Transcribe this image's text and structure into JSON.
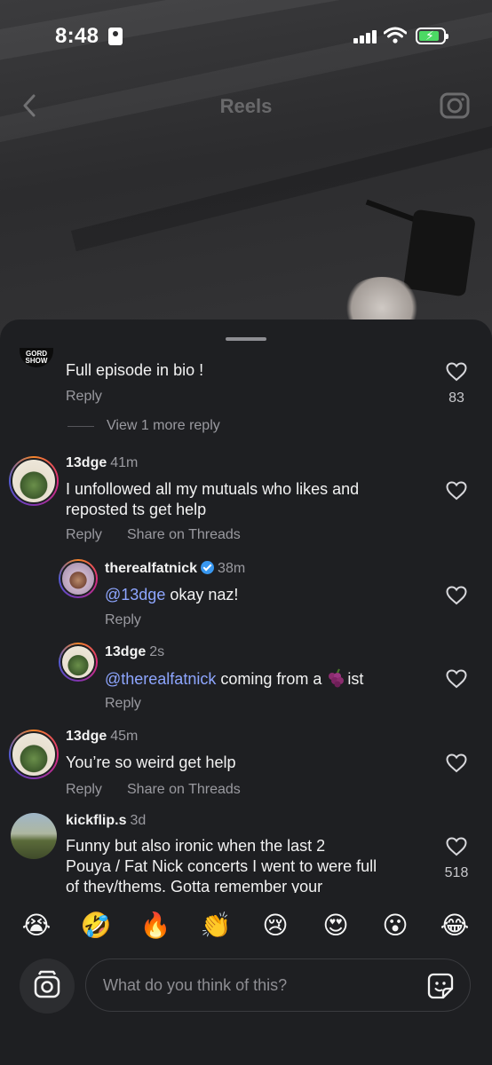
{
  "status_bar": {
    "time": "8:48"
  },
  "nav": {
    "title": "Reels"
  },
  "comments": [
    {
      "user": "",
      "text": "Full episode  in bio !",
      "reply": "Reply",
      "likes": "83"
    },
    {
      "view_more": "View 1 more reply"
    },
    {
      "user": "13dge",
      "time": "41m",
      "text_line1": "I unfollowed all my mutuals who likes and",
      "text_line2": "reposted ts get help",
      "reply": "Reply",
      "share": "Share on Threads"
    },
    {
      "user": "therealfatnick",
      "time": "38m",
      "mention": "@13dge",
      "text": " okay naz!",
      "reply": "Reply"
    },
    {
      "user": "13dge",
      "time": "2s",
      "mention": "@therealfatnick",
      "text_before": " coming from a ",
      "text_after": "ist",
      "reply": "Reply"
    },
    {
      "user": "13dge",
      "time": "45m",
      "text": "You’re so weird get help",
      "reply": "Reply",
      "share": "Share on Threads"
    },
    {
      "user": "kickflip.s",
      "time": "3d",
      "text_line1": "Funny but also ironic when the last 2",
      "text_line2": "Pouya / Fat Nick concerts I went to were full",
      "text_line3": "of they/thems. Gotta remember your",
      "likes": "518"
    }
  ],
  "emoji_bar": [
    "😭",
    "🤣",
    "🔥",
    "👏",
    "😢",
    "😍",
    "😮",
    "😂"
  ],
  "composer": {
    "placeholder": "What do you think of this?"
  },
  "icons": {
    "back": "chevron-left-icon",
    "camera": "camera-icon",
    "heart": "heart-outline-icon",
    "sticker": "sticker-icon",
    "grape": "grape-emoji-icon"
  },
  "colors": {
    "accent_mention": "#8ea6ff",
    "verified": "#3897f0",
    "battery": "#4cd964"
  }
}
